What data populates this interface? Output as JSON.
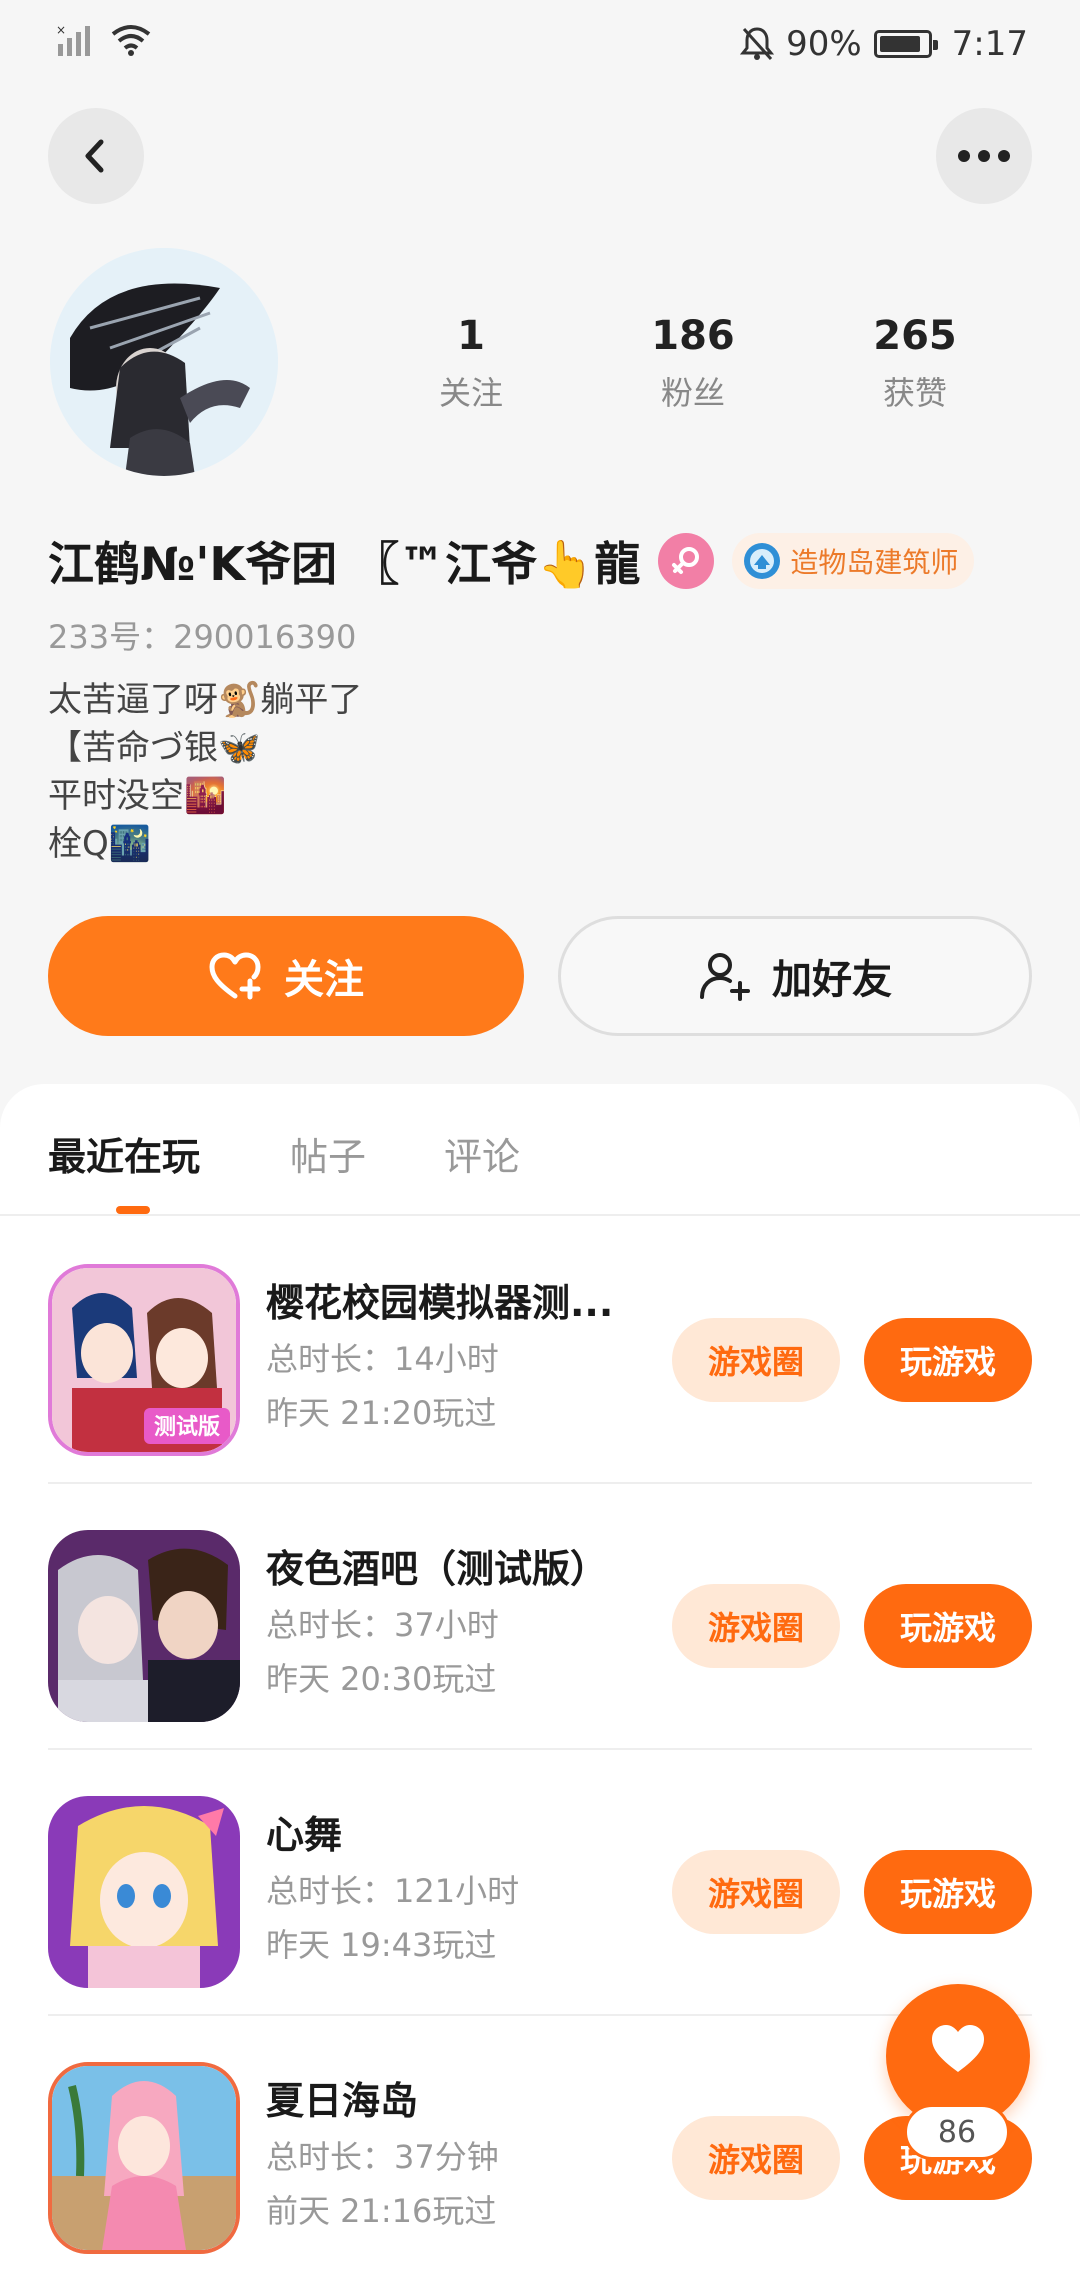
{
  "status_bar": {
    "battery_percent": "90%",
    "battery_level": 0.9,
    "time": "7:17"
  },
  "nav": {
    "back_icon": "chevron-left-icon",
    "more_icon": "more-icon"
  },
  "profile": {
    "stats": [
      {
        "value": "1",
        "label": "关注"
      },
      {
        "value": "186",
        "label": "粉丝"
      },
      {
        "value": "265",
        "label": "获赞"
      }
    ],
    "username": "江鹤№'K爷团 〖™江爷👆龍",
    "gender_icon": "female-icon",
    "title_badge": "造物岛建筑师",
    "uid": "233号：290016390",
    "bio": [
      "太苦逼了呀🐒躺平了",
      "【苦命づ银🦋",
      "平时没空🌇",
      "栓Q🌃"
    ]
  },
  "actions": {
    "follow_label": "关注",
    "add_friend_label": "加好友"
  },
  "tabs": [
    {
      "label": "最近在玩",
      "active": true
    },
    {
      "label": "帖子",
      "active": false
    },
    {
      "label": "评论",
      "active": false
    }
  ],
  "games": [
    {
      "name": "樱花校园模拟器测...",
      "duration": "总时长：14小时",
      "last_played": "昨天 21:20玩过",
      "circle_label": "游戏圈",
      "play_label": "玩游戏",
      "icon_tag": "测试版"
    },
    {
      "name": "夜色酒吧（测试版）",
      "duration": "总时长：37小时",
      "last_played": "昨天 20:30玩过",
      "circle_label": "游戏圈",
      "play_label": "玩游戏"
    },
    {
      "name": "心舞",
      "duration": "总时长：121小时",
      "last_played": "昨天 19:43玩过",
      "circle_label": "游戏圈",
      "play_label": "玩游戏"
    },
    {
      "name": "夏日海岛",
      "duration": "总时长：37分钟",
      "last_played": "前天 21:16玩过",
      "circle_label": "游戏圈",
      "play_label": "玩游戏"
    }
  ],
  "floating_like": {
    "icon": "heart-icon",
    "count": "86"
  },
  "colors": {
    "accent": "#ff6a10",
    "accent_light": "#ffe8d6",
    "badge_bg": "#fdf0e6",
    "gender": "#f27fa6"
  }
}
